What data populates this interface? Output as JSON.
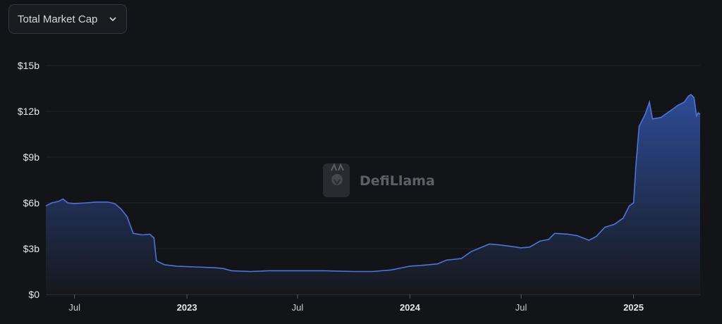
{
  "metric_selector": {
    "selected": "Total Market Cap",
    "icon": "chevron-down-icon"
  },
  "watermark": {
    "text": "DefiLlama",
    "icon": "llama-logo-icon"
  },
  "colors": {
    "background": "#131417",
    "line": "#4f74d9",
    "area_top": "#2f4f9e",
    "area_bottom": "#16181d",
    "gridline": "#22242a"
  },
  "chart_data": {
    "type": "area",
    "title": "",
    "xlabel": "",
    "ylabel": "",
    "y_unit": "USD billions",
    "ylim": [
      0,
      15
    ],
    "xlim": [
      "2022-05-15",
      "2025-04-20"
    ],
    "grid": {
      "horizontal": true,
      "vertical": false
    },
    "legend": "none",
    "y_ticks": [
      {
        "value": 0,
        "label": "$0"
      },
      {
        "value": 3,
        "label": "$3b"
      },
      {
        "value": 6,
        "label": "$6b"
      },
      {
        "value": 9,
        "label": "$9b"
      },
      {
        "value": 12,
        "label": "$12b"
      },
      {
        "value": 15,
        "label": "$15b"
      }
    ],
    "x_ticks": [
      {
        "date": "2022-07-01",
        "label": "Jul",
        "bold": false
      },
      {
        "date": "2023-01-01",
        "label": "2023",
        "bold": true
      },
      {
        "date": "2023-07-01",
        "label": "Jul",
        "bold": false
      },
      {
        "date": "2024-01-01",
        "label": "2024",
        "bold": true
      },
      {
        "date": "2024-07-01",
        "label": "Jul",
        "bold": false
      },
      {
        "date": "2025-01-01",
        "label": "2025",
        "bold": true
      }
    ],
    "series": [
      {
        "points": [
          [
            "2022-05-15",
            5.8
          ],
          [
            "2022-05-25",
            6.0
          ],
          [
            "2022-06-05",
            6.1
          ],
          [
            "2022-06-12",
            6.25
          ],
          [
            "2022-06-20",
            6.0
          ],
          [
            "2022-07-01",
            5.95
          ],
          [
            "2022-07-20",
            6.0
          ],
          [
            "2022-08-05",
            6.05
          ],
          [
            "2022-08-25",
            6.05
          ],
          [
            "2022-09-05",
            5.95
          ],
          [
            "2022-09-15",
            5.6
          ],
          [
            "2022-09-25",
            5.1
          ],
          [
            "2022-10-05",
            4.0
          ],
          [
            "2022-10-20",
            3.9
          ],
          [
            "2022-11-01",
            3.95
          ],
          [
            "2022-11-08",
            3.7
          ],
          [
            "2022-11-12",
            2.2
          ],
          [
            "2022-11-25",
            1.95
          ],
          [
            "2022-12-15",
            1.85
          ],
          [
            "2023-01-15",
            1.8
          ],
          [
            "2023-02-15",
            1.75
          ],
          [
            "2023-03-01",
            1.7
          ],
          [
            "2023-03-15",
            1.55
          ],
          [
            "2023-04-15",
            1.5
          ],
          [
            "2023-05-15",
            1.55
          ],
          [
            "2023-07-01",
            1.55
          ],
          [
            "2023-08-15",
            1.55
          ],
          [
            "2023-10-01",
            1.5
          ],
          [
            "2023-11-01",
            1.5
          ],
          [
            "2023-12-01",
            1.6
          ],
          [
            "2024-01-01",
            1.85
          ],
          [
            "2024-01-20",
            1.9
          ],
          [
            "2024-02-15",
            2.0
          ],
          [
            "2024-03-01",
            2.25
          ],
          [
            "2024-03-25",
            2.35
          ],
          [
            "2024-04-10",
            2.8
          ],
          [
            "2024-04-25",
            3.05
          ],
          [
            "2024-05-10",
            3.3
          ],
          [
            "2024-05-25",
            3.25
          ],
          [
            "2024-06-15",
            3.15
          ],
          [
            "2024-07-01",
            3.05
          ],
          [
            "2024-07-15",
            3.1
          ],
          [
            "2024-08-01",
            3.5
          ],
          [
            "2024-08-15",
            3.6
          ],
          [
            "2024-08-25",
            4.0
          ],
          [
            "2024-09-15",
            3.95
          ],
          [
            "2024-10-01",
            3.85
          ],
          [
            "2024-10-20",
            3.55
          ],
          [
            "2024-11-01",
            3.8
          ],
          [
            "2024-11-15",
            4.4
          ],
          [
            "2024-12-01",
            4.6
          ],
          [
            "2024-12-15",
            5.0
          ],
          [
            "2024-12-25",
            5.8
          ],
          [
            "2025-01-01",
            6.0
          ],
          [
            "2025-01-05",
            8.5
          ],
          [
            "2025-01-10",
            11.0
          ],
          [
            "2025-01-20",
            11.8
          ],
          [
            "2025-01-27",
            12.6
          ],
          [
            "2025-02-01",
            11.5
          ],
          [
            "2025-02-15",
            11.6
          ],
          [
            "2025-03-01",
            12.0
          ],
          [
            "2025-03-15",
            12.4
          ],
          [
            "2025-03-25",
            12.6
          ],
          [
            "2025-04-01",
            13.0
          ],
          [
            "2025-04-05",
            13.1
          ],
          [
            "2025-04-10",
            12.9
          ],
          [
            "2025-04-14",
            11.7
          ],
          [
            "2025-04-17",
            11.9
          ],
          [
            "2025-04-20",
            11.8
          ]
        ]
      }
    ]
  }
}
